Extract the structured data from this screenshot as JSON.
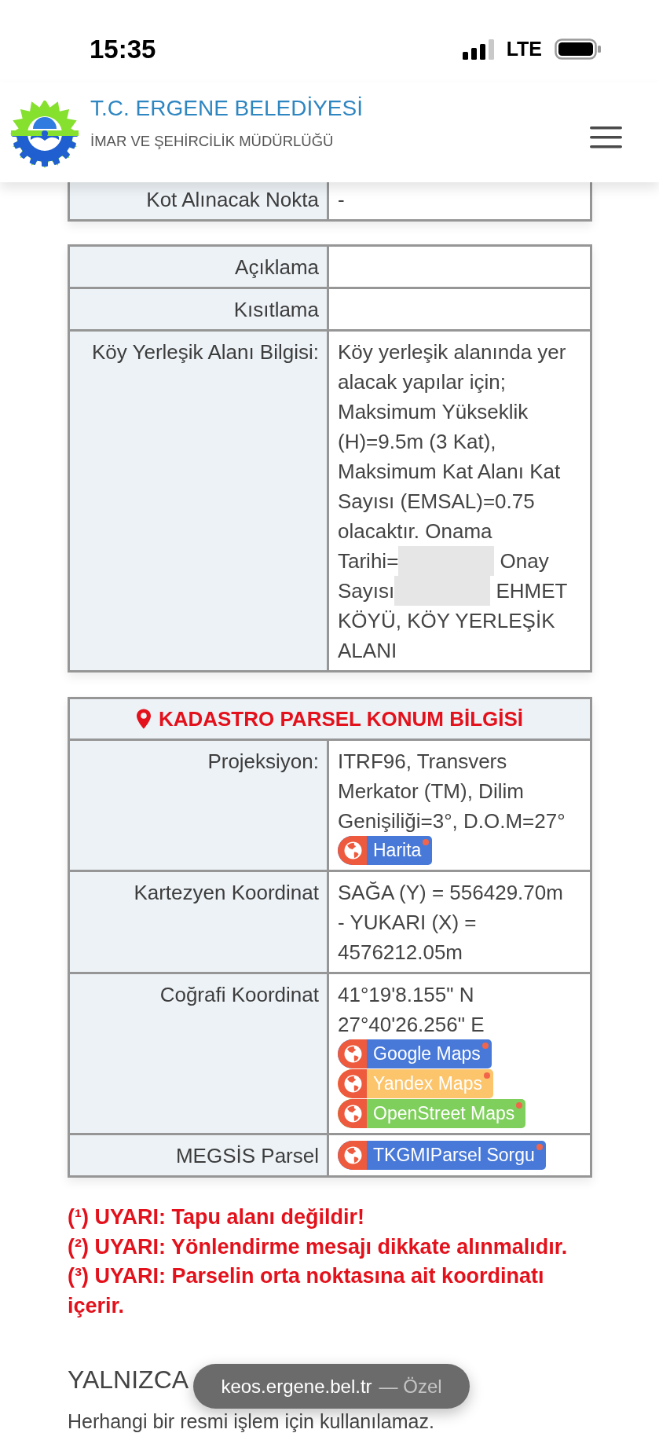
{
  "status_bar": {
    "time": "15:35",
    "network": "LTE"
  },
  "header": {
    "title": "T.C. ERGENE BELEDİYESİ",
    "subtitle": "İMAR VE ŞEHİRCİLİK MÜDÜRLÜĞÜ"
  },
  "tables": [
    {
      "rows": [
        {
          "label": "Kot Alınacak Nokta",
          "value": "-"
        }
      ]
    },
    {
      "rows": [
        {
          "label": "Açıklama"
        },
        {
          "label": "Kısıtlama"
        },
        {
          "label": "Köy Yerleşik Alanı Bilgisi:",
          "value_parts": [
            "Köy yerleşik alanında yer alacak yapılar için; Maksimum Yükseklik (H)=9.5m (3 Kat), Maksimum Kat Alanı Kat Sayısı (EMSAL)=0.75 olacaktır. Onama Tarihi=",
            "Onay Sayısı",
            "EHMET KÖYÜ, KÖY YERLEŞİK ALANI"
          ]
        }
      ]
    },
    {
      "title": "KADASTRO PARSEL KONUM BİLGİSİ",
      "rows": [
        {
          "label": "Projeksiyon:",
          "value": "ITRF96, Transvers Merkator (TM), Dilim Genişiliği=3°, D.O.M=27°",
          "links": [
            {
              "label": "Harita",
              "color": "#4879d8"
            }
          ]
        },
        {
          "label": "Kartezyen Koordinat",
          "value": "SAĞA (Y) = 556429.70m - YUKARI (X) = 4576212.05m"
        },
        {
          "label": "Coğrafi Koordinat",
          "value": "41°19'8.155\" N 27°40'26.256\" E",
          "links": [
            {
              "label": "Google Maps",
              "color": "#4879d8"
            },
            {
              "label": "Yandex Maps",
              "color": "#fcc46b"
            },
            {
              "label": "OpenStreet Maps",
              "color": "#7ecf5b"
            }
          ]
        },
        {
          "label": "MEGSİS Parsel",
          "links": [
            {
              "label": "TKGMIParsel Sorgu",
              "color": "#4879d8"
            }
          ]
        }
      ]
    }
  ],
  "warnings": [
    "(¹) UYARI: Tapu alanı değildir!",
    "(²) UYARI: Yönlendirme mesajı dikkate alınmalıdır.",
    "(³) UYARI: Parselin orta noktasına ait koordinatı içerir."
  ],
  "footer": {
    "heading": "YALNIZCA",
    "note": "Herhangi bir resmi işlem için kullanılamaz."
  },
  "url_pill": {
    "domain": "keos.ergene.bel.tr",
    "mode": "— Özel"
  }
}
